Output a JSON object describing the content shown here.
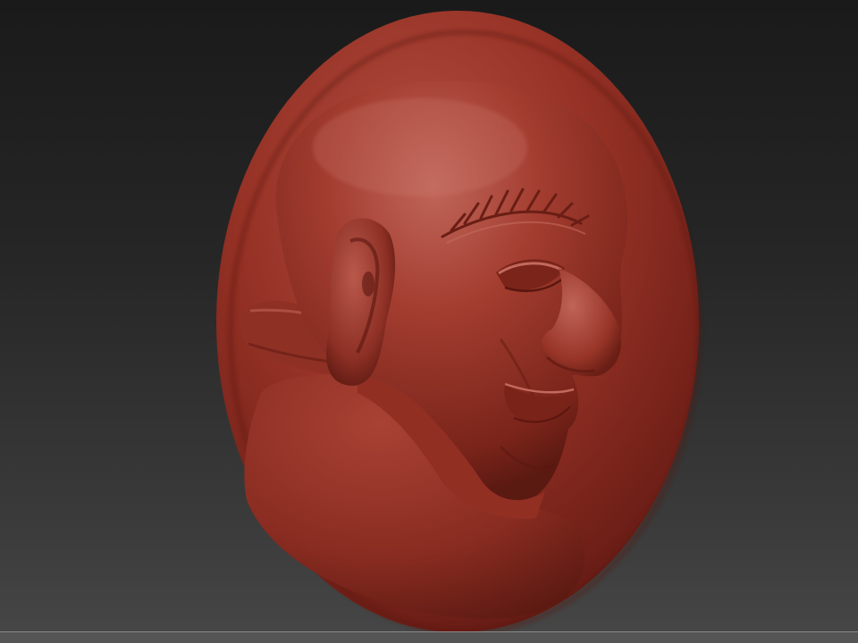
{
  "scene": {
    "background_top": "#1a1a1a",
    "background_bottom": "#474747",
    "material_color": "#9a3428",
    "material_highlight": "#b8574a",
    "material_shadow": "#4e140f"
  },
  "subject": {
    "type": "sculpted relief medallion",
    "icon": "medallion-relief-icon"
  }
}
